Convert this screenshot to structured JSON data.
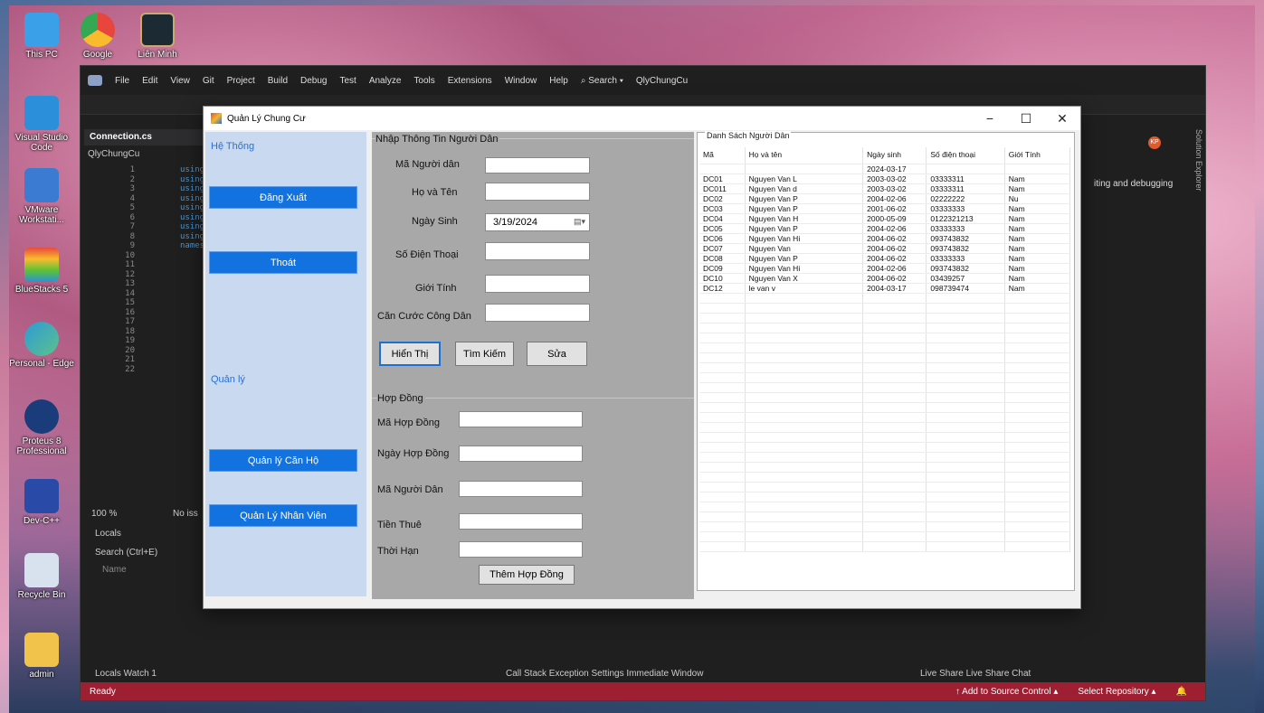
{
  "desktop_icons": [
    {
      "label": "This PC",
      "icon": "monitor-icon",
      "color": "#3aa0e8"
    },
    {
      "label": "Google",
      "icon": "chrome-icon",
      "color": "#e8453c"
    },
    {
      "label": "Liên Minh",
      "icon": "league-icon",
      "color": "#c8aa6e"
    },
    {
      "label": "Visual Studio Code",
      "icon": "vscode-icon",
      "color": "#2b90d9"
    },
    {
      "label": "VMware Workstati...",
      "icon": "vmware-icon",
      "color": "#3b7bd1"
    },
    {
      "label": "BlueStacks 5",
      "icon": "bluestacks-icon",
      "color": "#5bc236"
    },
    {
      "label": "Personal - Edge",
      "icon": "edge-icon",
      "color": "#2f9ad6"
    },
    {
      "label": "Proteus 8 Professional",
      "icon": "proteus-icon",
      "color": "#1a3c7a"
    },
    {
      "label": "Dev-C++",
      "icon": "devcpp-icon",
      "color": "#2a4aa8"
    },
    {
      "label": "Recycle Bin",
      "icon": "recycle-bin-icon",
      "color": "#d8e2ee"
    },
    {
      "label": "admin",
      "icon": "folder-icon",
      "color": "#f2c34a"
    }
  ],
  "vs": {
    "menu": [
      "File",
      "Edit",
      "View",
      "Git",
      "Project",
      "Build",
      "Debug",
      "Test",
      "Analyze",
      "Tools",
      "Extensions",
      "Window",
      "Help",
      "Search",
      "QlyChungCu"
    ],
    "avatar": "KP",
    "doc_tab": "Connection.cs",
    "solution_node": "QlyChungCu",
    "line_numbers": [
      "1",
      "2",
      "3",
      "4",
      "5",
      "6",
      "7",
      "8",
      "9",
      "10",
      "11",
      "12",
      "13",
      "14",
      "15",
      "16",
      "17",
      "18",
      "19",
      "20",
      "21",
      "22"
    ],
    "code_keywords": [
      "using",
      "using",
      "using",
      "using",
      "using",
      "using",
      "using",
      "using",
      "names"
    ],
    "zoom": "100 %",
    "issues": "No iss",
    "locals_title": "Locals",
    "search_placeholder": "Search (Ctrl+E)",
    "name_col": "Name",
    "bottom_tabs_left": "Locals  Watch 1",
    "bottom_tabs_mid": "Call Stack  Exception Settings  Immediate Window",
    "bottom_tabs_right": "Live Share  Live Share Chat",
    "right_hint": "iting and debugging",
    "solution_explorer": "Solution Explorer",
    "status_ready": "Ready",
    "status_add_source": "↑  Add to Source Control  ▴",
    "status_repo": "Select Repository  ▴"
  },
  "form": {
    "title": "Quản Lý Chung Cư",
    "left": {
      "group_system": "Hệ Thống",
      "btn_logout": "Đăng Xuất",
      "btn_exit": "Thoát",
      "group_manage": "Quản lý",
      "btn_apartment": "Quản lý Căn Hộ",
      "btn_staff": "Quản Lý Nhân Viên"
    },
    "resident": {
      "section": "Nhập Thông Tin Người Dân",
      "label_id": "Mã Người dân",
      "label_name": "Họ và Tên",
      "label_dob": "Ngày Sinh",
      "dob_value": "3/19/2024",
      "label_phone": "Số Điện Thoại",
      "label_gender": "Giới Tính",
      "label_cccd": "Căn Cước Công Dân",
      "btn_show": "Hiển Thị",
      "btn_search": "Tìm Kiếm",
      "btn_edit": "Sửa"
    },
    "contract": {
      "section": "Hợp Đồng",
      "label_id": "Mã Hợp Đồng",
      "label_date": "Ngày Hợp Đồng",
      "label_resident": "Mã Người Dân",
      "label_rent": "Tiền Thuê",
      "label_term": "Thời Hạn",
      "btn_add": "Thêm Hợp Đồng"
    },
    "list": {
      "title": "Danh Sách Người Dân",
      "columns": [
        "Mã",
        "Họ và tên",
        "Ngày sinh",
        "Số điện thoại",
        "Giới Tính"
      ],
      "rows": [
        [
          "",
          "",
          "2024-03-17",
          "",
          ""
        ],
        [
          "DC01",
          "Nguyen Van L",
          "2003-03-02",
          "03333311",
          "Nam"
        ],
        [
          "DC011",
          "Nguyen Van d",
          "2003-03-02",
          "03333311",
          "Nam"
        ],
        [
          "DC02",
          "Nguyen Van P",
          "2004-02-06",
          "02222222",
          "Nu"
        ],
        [
          "DC03",
          "Nguyen Van P",
          "2001-06-02",
          "03333333",
          "Nam"
        ],
        [
          "DC04",
          "Nguyen Van H",
          "2000-05-09",
          "0122321213",
          "Nam"
        ],
        [
          "DC05",
          "Nguyen Van P",
          "2004-02-06",
          "03333333",
          "Nam"
        ],
        [
          "DC06",
          "Nguyen Van Hi",
          "2004-06-02",
          "093743832",
          "Nam"
        ],
        [
          "DC07",
          "Nguyen Van",
          "2004-06-02",
          "093743832",
          "Nam"
        ],
        [
          "DC08",
          "Nguyen Van P",
          "2004-06-02",
          "03333333",
          "Nam"
        ],
        [
          "DC09",
          "Nguyen Van Hi",
          "2004-02-06",
          "093743832",
          "Nam"
        ],
        [
          "DC10",
          "Nguyen Van X",
          "2004-06-02",
          "03439257",
          "Nam"
        ],
        [
          "DC12",
          "le van v",
          "2004-03-17",
          "098739474",
          "Nam"
        ]
      ],
      "empty_rows": 26
    }
  }
}
